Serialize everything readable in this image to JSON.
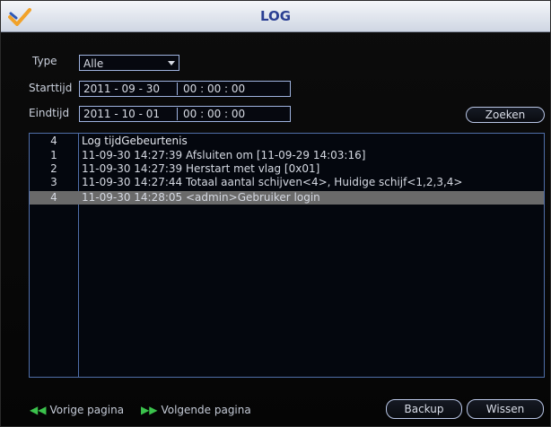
{
  "window": {
    "title": "LOG"
  },
  "filters": {
    "type_label": "Type",
    "type_value": "Alle",
    "start_label": "Starttijd",
    "start_date": "2011 - 09 - 30",
    "start_time": "00 : 00 : 00",
    "end_label": "Eindtijd",
    "end_date": "2011 - 10 - 01",
    "end_time": "00 : 00 : 00",
    "search_button": "Zoeken"
  },
  "table": {
    "header": {
      "count": "4",
      "label": "Log tijdGebeurtenis"
    },
    "rows": [
      {
        "no": "1",
        "text": "11-09-30 14:27:39  Afsluiten om [11-09-29 14:03:16]"
      },
      {
        "no": "2",
        "text": "11-09-30 14:27:39  Herstart met vlag [0x01]"
      },
      {
        "no": "3",
        "text": "11-09-30 14:27:44  Totaal aantal schijven<4>, Huidige schijf<1,2,3,4>"
      },
      {
        "no": "4",
        "text": "11-09-30 14:28:05  <admin>Gebruiker login"
      }
    ]
  },
  "footer": {
    "prev_page": "Vorige pagina",
    "next_page": "Volgende pagina",
    "backup_button": "Backup",
    "clear_button": "Wissen"
  }
}
